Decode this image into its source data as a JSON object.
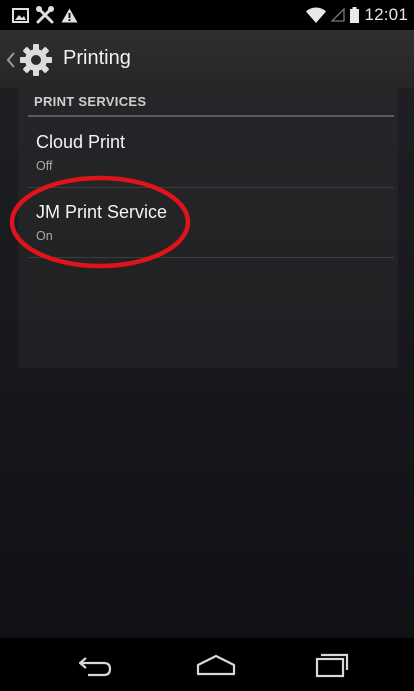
{
  "status_bar": {
    "time": "12:01",
    "left_icons": [
      "image-icon",
      "tools-icon",
      "warning-icon"
    ],
    "right_icons": [
      "wifi-icon",
      "signal-icon",
      "battery-icon"
    ]
  },
  "action_bar": {
    "title": "Printing",
    "icon": "gear-icon"
  },
  "section": {
    "header": "PRINT SERVICES"
  },
  "services": [
    {
      "title": "Cloud Print",
      "status": "Off"
    },
    {
      "title": "JM Print Service",
      "status": "On"
    }
  ],
  "annotation": {
    "color": "#e0131b",
    "target": "JM Print Service"
  },
  "nav_bar": {
    "buttons": [
      "back-icon",
      "home-icon",
      "recents-icon"
    ]
  }
}
